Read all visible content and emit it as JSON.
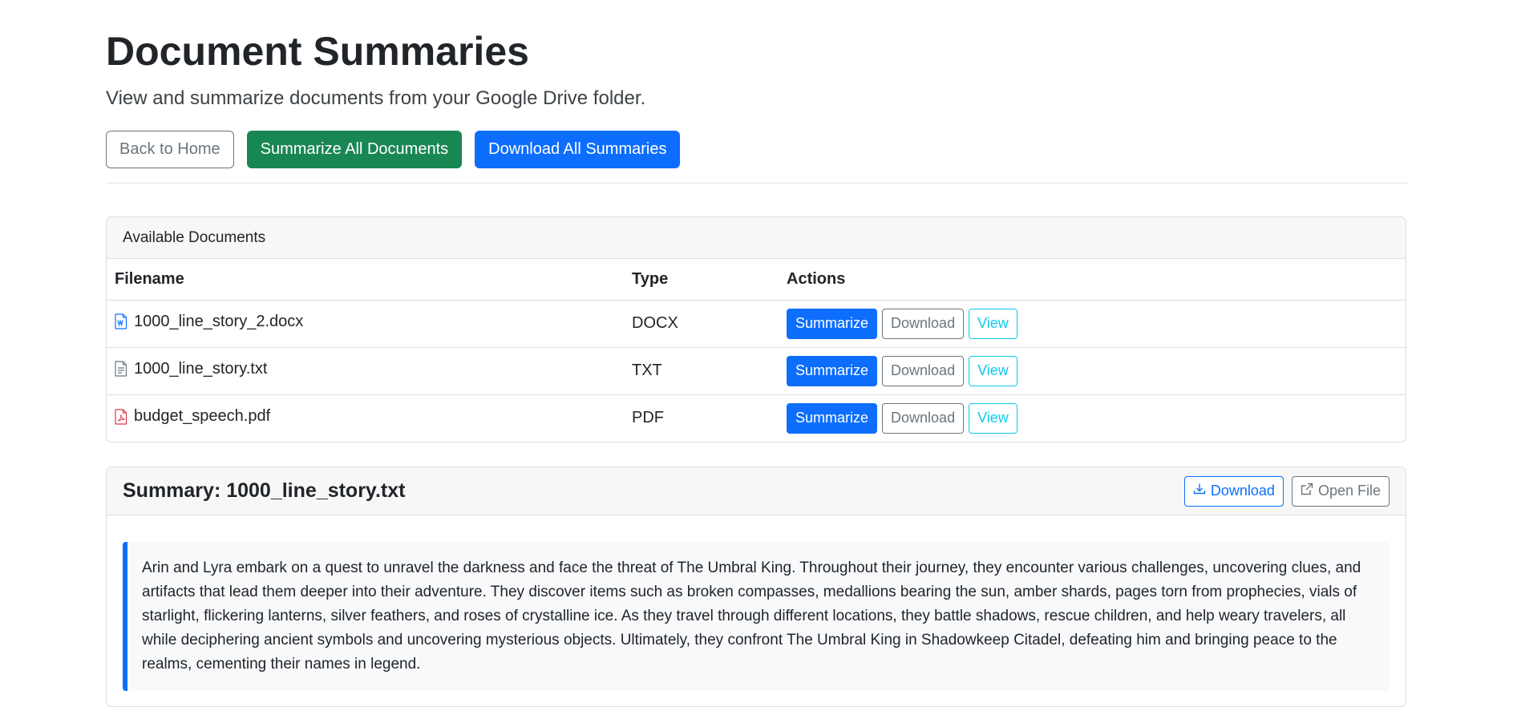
{
  "page": {
    "title": "Document Summaries",
    "subtitle": "View and summarize documents from your Google Drive folder."
  },
  "top_actions": {
    "back_label": "Back to Home",
    "summarize_all_label": "Summarize All Documents",
    "download_all_label": "Download All Summaries"
  },
  "documents_card": {
    "header": "Available Documents",
    "columns": [
      "Filename",
      "Type",
      "Actions"
    ],
    "rows": [
      {
        "filename": "1000_line_story_2.docx",
        "type": "DOCX",
        "icon": "word-file-icon"
      },
      {
        "filename": "1000_line_story.txt",
        "type": "TXT",
        "icon": "text-file-icon"
      },
      {
        "filename": "budget_speech.pdf",
        "type": "PDF",
        "icon": "pdf-file-icon"
      }
    ],
    "row_actions": {
      "summarize_label": "Summarize",
      "download_label": "Download",
      "view_label": "View"
    }
  },
  "summary_card": {
    "title": "Summary: 1000_line_story.txt",
    "download_label": "Download",
    "open_file_label": "Open File",
    "text": "Arin and Lyra embark on a quest to unravel the darkness and face the threat of The Umbral King. Throughout their journey, they encounter various challenges, uncovering clues, and artifacts that lead them deeper into their adventure. They discover items such as broken compasses, medallions bearing the sun, amber shards, pages torn from prophecies, vials of starlight, flickering lanterns, silver feathers, and roses of crystalline ice. As they travel through different locations, they battle shadows, rescue children, and help weary travelers, all while deciphering ancient symbols and uncovering mysterious objects. Ultimately, they confront The Umbral King in Shadowkeep Citadel, defeating him and bringing peace to the realms, cementing their names in legend."
  },
  "colors": {
    "primary": "#0d6efd",
    "success": "#198754",
    "secondary": "#6c757d",
    "info": "#0dcaf0",
    "pdf": "#dc3545"
  }
}
